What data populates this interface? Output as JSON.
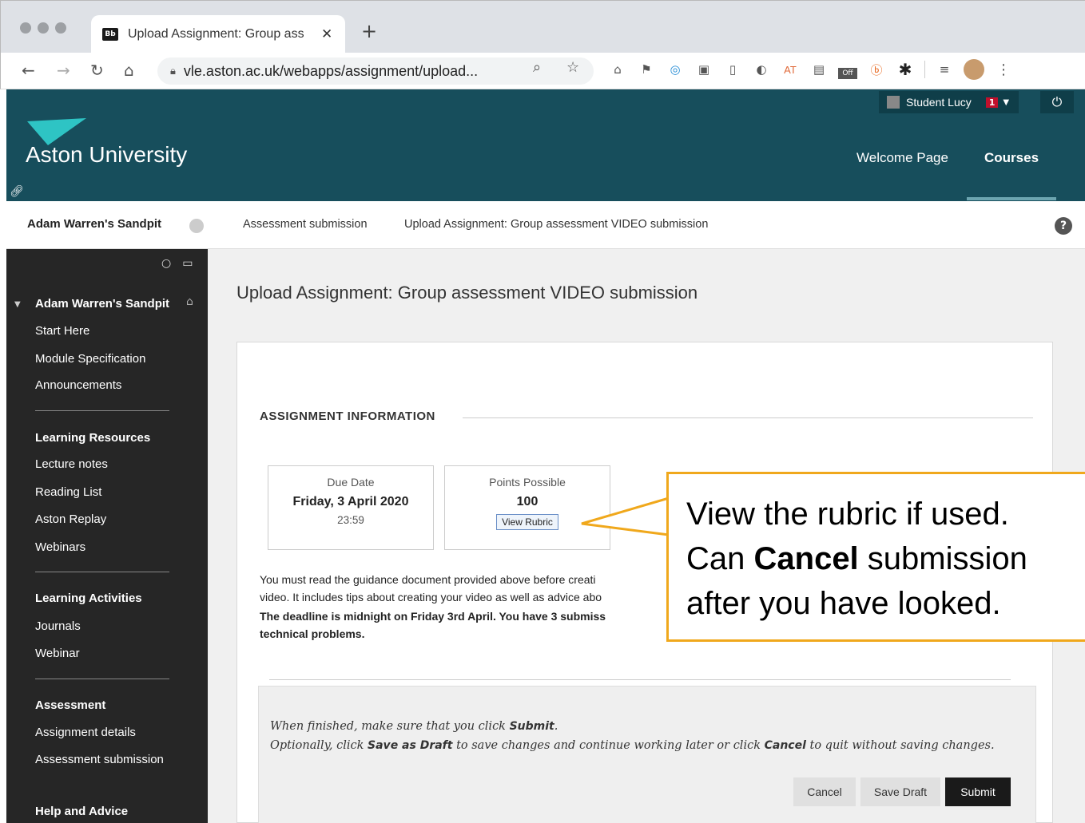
{
  "browser": {
    "tab_title": "Upload Assignment: Group ass",
    "tab_favicon": "Bb",
    "url": "vle.aston.ac.uk/webapps/assignment/upload..."
  },
  "header": {
    "logo_text": "Aston University",
    "user_name": "Student Lucy",
    "notification_count": "1",
    "nav": [
      "Welcome Page",
      "Courses"
    ]
  },
  "breadcrumb": {
    "course": "Adam Warren's Sandpit",
    "items": [
      "Assessment submission",
      "Upload Assignment: Group assessment VIDEO submission"
    ]
  },
  "sidebar": {
    "course_title": "Adam Warren's Sandpit",
    "group1": [
      "Start Here",
      "Module Specification",
      "Announcements"
    ],
    "learning_resources": {
      "heading": "Learning Resources",
      "items": [
        "Lecture notes",
        "Reading List",
        "Aston Replay",
        "Webinars"
      ]
    },
    "learning_activities": {
      "heading": "Learning Activities",
      "items": [
        "Journals",
        "Webinar"
      ]
    },
    "assessment": {
      "heading": "Assessment",
      "items": [
        "Assignment details",
        "Assessment submission"
      ]
    },
    "help": {
      "heading": "Help and Advice"
    }
  },
  "main": {
    "page_title": "Upload Assignment: Group assessment VIDEO submission",
    "section_heading": "ASSIGNMENT INFORMATION",
    "due": {
      "label": "Due Date",
      "date": "Friday, 3 April 2020",
      "time": "23:59"
    },
    "points": {
      "label": "Points Possible",
      "value": "100",
      "rubric_button": "View Rubric"
    },
    "guidance_line1": "You must read the guidance document provided above before creati",
    "guidance_line2": "video. It includes tips about creating your video as well as advice abo",
    "deadline_line1": "The deadline is midnight on Friday 3rd April. You have 3 submiss",
    "deadline_line2": "technical problems.",
    "instr1_pre": "When finished, make sure that you click ",
    "instr1_bold": "Submit",
    "instr1_post": ".",
    "instr2_pre": "Optionally, click ",
    "instr2_bold1": "Save as Draft",
    "instr2_mid": " to save changes and continue working later or click ",
    "instr2_bold2": "Cancel",
    "instr2_post": " to quit without saving changes.",
    "buttons": {
      "cancel": "Cancel",
      "save_draft": "Save Draft",
      "submit": "Submit"
    }
  },
  "callout": {
    "line1": "View the rubric if used.",
    "line2_pre": "Can ",
    "line2_bold": "Cancel",
    "line2_post": " submission",
    "line3": "after you have looked."
  },
  "colors": {
    "header_bg": "#174e5c",
    "sidebar_bg": "#262626",
    "callout_border": "#f0a81c",
    "submit_bg": "#1a1a1a"
  }
}
